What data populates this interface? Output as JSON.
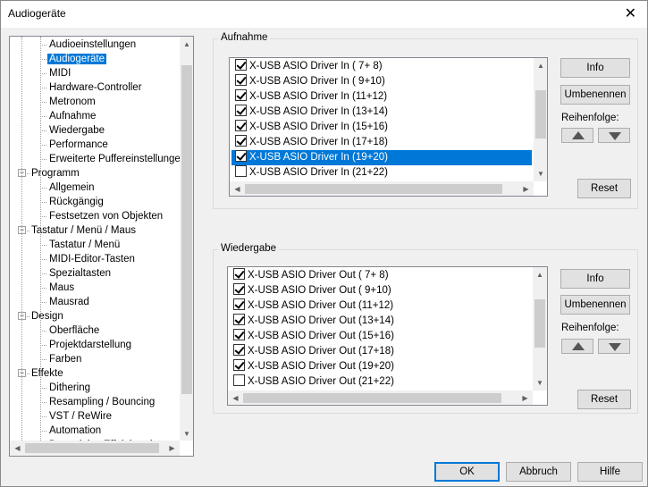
{
  "window": {
    "title": "Audiogeräte",
    "close_glyph": "✕"
  },
  "tree": {
    "items": [
      {
        "label": "Audioeinstellungen"
      },
      {
        "label": "Audiogeräte"
      },
      {
        "label": "MIDI"
      },
      {
        "label": "Hardware-Controller"
      },
      {
        "label": "Metronom"
      },
      {
        "label": "Aufnahme"
      },
      {
        "label": "Wiedergabe"
      },
      {
        "label": "Performance"
      },
      {
        "label": "Erweiterte Puffereinstellungen"
      },
      {
        "label": "Programm"
      },
      {
        "label": "Allgemein"
      },
      {
        "label": "Rückgängig"
      },
      {
        "label": "Festsetzen von Objekten"
      },
      {
        "label": "Tastatur / Menü / Maus"
      },
      {
        "label": "Tastatur / Menü"
      },
      {
        "label": "MIDI-Editor-Tasten"
      },
      {
        "label": "Spezialtasten"
      },
      {
        "label": "Maus"
      },
      {
        "label": "Mausrad"
      },
      {
        "label": "Design"
      },
      {
        "label": "Oberfläche"
      },
      {
        "label": "Projektdarstellung"
      },
      {
        "label": "Farben"
      },
      {
        "label": "Effekte"
      },
      {
        "label": "Dithering"
      },
      {
        "label": "Resampling / Bouncing"
      },
      {
        "label": "VST / ReWire"
      },
      {
        "label": "Automation"
      },
      {
        "label": "Destruktive Effektbearb..."
      }
    ]
  },
  "recording": {
    "title": "Aufnahme",
    "items": [
      {
        "label": "X-USB ASIO Driver In ( 7+ 8)",
        "checked": true
      },
      {
        "label": "X-USB ASIO Driver In ( 9+10)",
        "checked": true
      },
      {
        "label": "X-USB ASIO Driver In (11+12)",
        "checked": true
      },
      {
        "label": "X-USB ASIO Driver In (13+14)",
        "checked": true
      },
      {
        "label": "X-USB ASIO Driver In (15+16)",
        "checked": true
      },
      {
        "label": "X-USB ASIO Driver In (17+18)",
        "checked": true
      },
      {
        "label": "X-USB ASIO Driver In (19+20)",
        "checked": true
      },
      {
        "label": "X-USB ASIO Driver In (21+22)",
        "checked": false
      }
    ],
    "info": "Info",
    "rename": "Umbenennen",
    "order_label": "Reihenfolge:",
    "reset": "Reset"
  },
  "playback": {
    "title": "Wiedergabe",
    "items": [
      {
        "label": "X-USB ASIO Driver Out ( 7+ 8)",
        "checked": true
      },
      {
        "label": "X-USB ASIO Driver Out ( 9+10)",
        "checked": true
      },
      {
        "label": "X-USB ASIO Driver Out (11+12)",
        "checked": true
      },
      {
        "label": "X-USB ASIO Driver Out (13+14)",
        "checked": true
      },
      {
        "label": "X-USB ASIO Driver Out (15+16)",
        "checked": true
      },
      {
        "label": "X-USB ASIO Driver Out (17+18)",
        "checked": true
      },
      {
        "label": "X-USB ASIO Driver Out (19+20)",
        "checked": true
      },
      {
        "label": "X-USB ASIO Driver Out (21+22)",
        "checked": false
      }
    ],
    "info": "Info",
    "rename": "Umbenennen",
    "order_label": "Reihenfolge:",
    "reset": "Reset"
  },
  "footer": {
    "ok": "OK",
    "cancel": "Abbruch",
    "help": "Hilfe"
  }
}
